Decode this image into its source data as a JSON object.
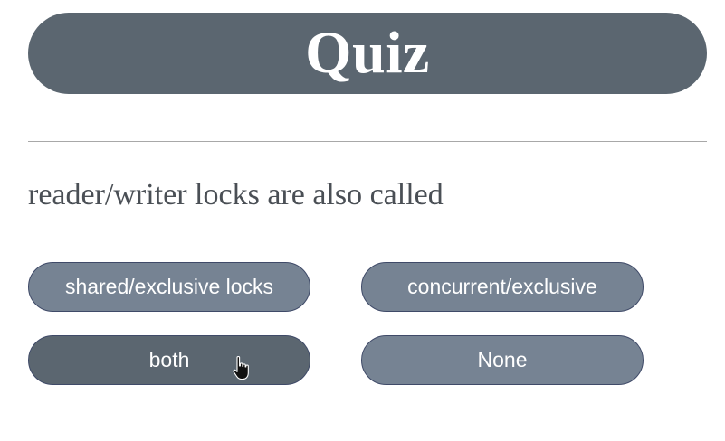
{
  "quiz": {
    "title": "Quiz",
    "question": "reader/writer locks are also called",
    "options": [
      {
        "label": "shared/exclusive locks"
      },
      {
        "label": "concurrent/exclusive"
      },
      {
        "label": "both",
        "state": "hovered"
      },
      {
        "label": "None"
      }
    ]
  },
  "colors": {
    "title_background": "#5b6670",
    "option_background": "#768393",
    "option_hover_background": "#5b6670",
    "option_border": "#3f4a68",
    "question_text": "#4a4f55"
  },
  "cursor": {
    "icon": "hand-pointer-icon"
  }
}
